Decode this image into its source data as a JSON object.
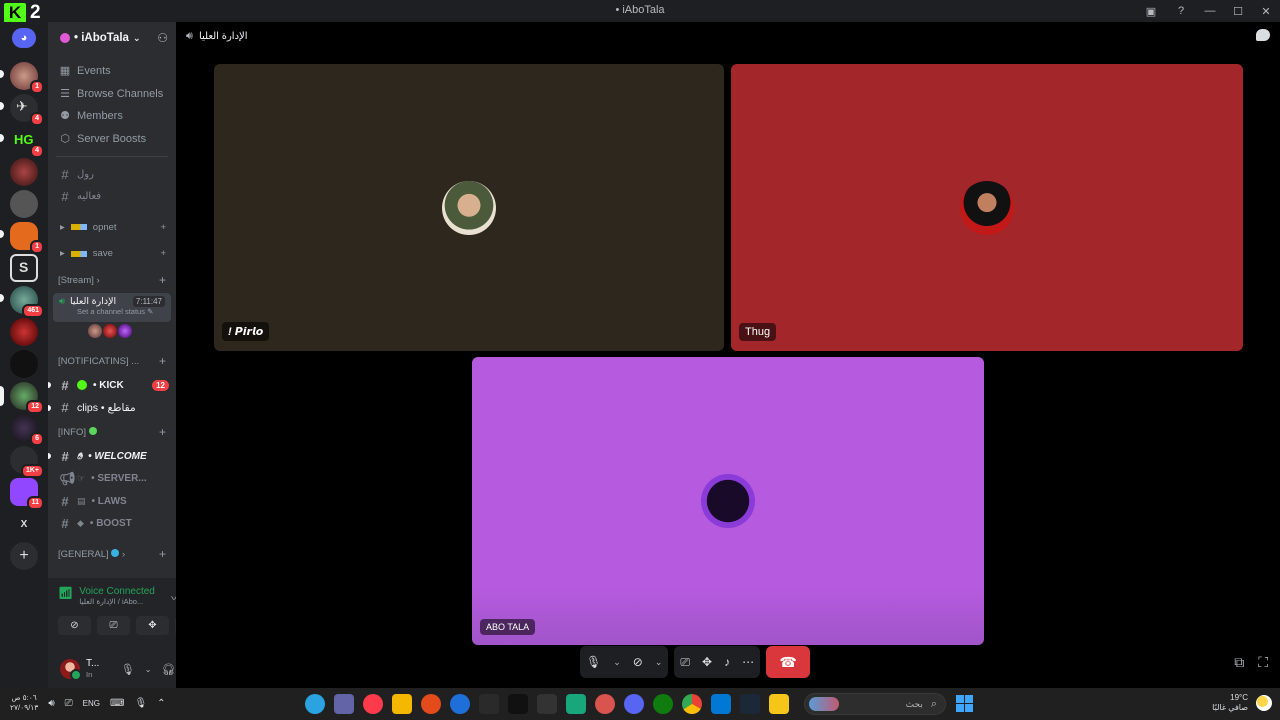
{
  "titlebar": {
    "kick_num": "2",
    "window_title": "• iAboTala"
  },
  "rail": {
    "badges": [
      "1",
      "4",
      "4",
      "1",
      "461",
      "12",
      "6",
      "1K+",
      "11"
    ],
    "x_label": "X"
  },
  "sidebar": {
    "server_name": "• iAboTala",
    "nav": [
      {
        "label": "Events",
        "icon": "calendar-icon"
      },
      {
        "label": "Browse Channels",
        "icon": "browse-icon"
      },
      {
        "label": "Members",
        "icon": "members-icon"
      },
      {
        "label": "Server Boosts",
        "icon": "boost-icon"
      }
    ],
    "channels_top": [
      "رول",
      "فعاليه"
    ],
    "folders": [
      "opnet",
      "save"
    ],
    "stream_category": "[Stream]",
    "voice_channel": {
      "name": "الإدارة العليا",
      "time": "7:11:47",
      "status": "Set a channel status"
    },
    "notif_category": "[NOTIFICATINS] ...",
    "notif_channels": [
      {
        "label": "• KICK",
        "badge": "12"
      },
      {
        "label": "clips • مقاطع"
      }
    ],
    "info_category": "[INFO]",
    "info_channels": [
      "• WELCOME",
      "• SERVER...",
      "• LAWS",
      "• BOOST"
    ],
    "general_category": "[GENERAL]"
  },
  "voice_panel": {
    "title": "Voice Connected",
    "subtitle": "الإدارة العليا / iAbo...",
    "user_name": "T...",
    "user_status": "In"
  },
  "stage": {
    "channel": "الإدارة العليا",
    "tiles": [
      {
        "label": "! 𝙋𝙞𝙧𝙡𝙤",
        "bg": "#2e271e"
      },
      {
        "label": "Thug",
        "bg": "#a3262a"
      },
      {
        "label": "ABO TALA",
        "bg": "#b65ae0"
      }
    ]
  },
  "taskbar": {
    "time": "٥:٠٦ ص",
    "date": "٢٧/٠٩/١٣",
    "lang": "ENG",
    "search_placeholder": "بحث",
    "weather_temp": "19°C",
    "weather_desc": "صافي غالبًا"
  }
}
